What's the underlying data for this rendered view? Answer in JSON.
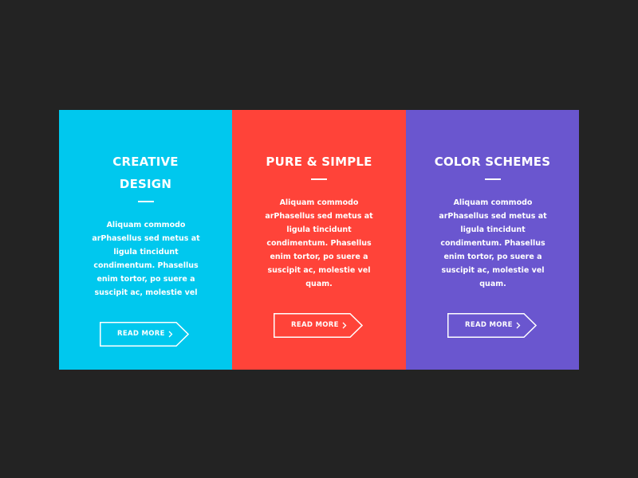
{
  "colors": {
    "background": "#232323",
    "card_1": "#00C8EE",
    "card_2": "#FF4339",
    "card_3": "#6A56CF",
    "text": "#FFFFFF"
  },
  "cards": [
    {
      "title": "CREATIVE DESIGN",
      "body": "Aliquam commodo arPhasellus sed metus at ligula tincidunt condimentum. Phasellus enim tortor, po suere a suscipit ac, molestie vel",
      "button_label": "READ MORE",
      "button_icon": "chevron-right-icon"
    },
    {
      "title": "PURE & SIMPLE",
      "body": "Aliquam commodo arPhasellus sed metus at ligula tincidunt condimentum. Phasellus enim tortor, po suere a suscipit ac, molestie vel quam.",
      "button_label": "READ MORE",
      "button_icon": "chevron-right-icon"
    },
    {
      "title": "COLOR SCHEMES",
      "body": "Aliquam commodo arPhasellus sed metus at ligula tincidunt condimentum. Phasellus enim tortor, po suere a suscipit ac, molestie vel quam.",
      "button_label": "READ MORE",
      "button_icon": "chevron-right-icon"
    }
  ]
}
